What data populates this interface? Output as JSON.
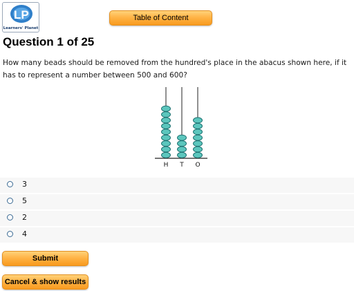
{
  "logo": {
    "brand_text": "Learners' Planet",
    "icon": "learners-planet-logo"
  },
  "header": {
    "toc_label": "Table of Content"
  },
  "question": {
    "title": "Question 1 of 25",
    "text": "How many beads should be removed from the hundred's place in the abacus shown here, if it has to represent a number between 500 and 600?"
  },
  "abacus": {
    "rods": [
      {
        "label": "H",
        "beads": 9
      },
      {
        "label": "T",
        "beads": 4
      },
      {
        "label": "O",
        "beads": 7
      }
    ],
    "bead_color": "#5cc6bd",
    "bead_outline": "#1c6f6f"
  },
  "options": [
    {
      "label": "3"
    },
    {
      "label": "5"
    },
    {
      "label": "2"
    },
    {
      "label": "4"
    }
  ],
  "actions": {
    "submit_label": "Submit",
    "cancel_label": "Cancel & show results"
  },
  "colors": {
    "button_orange": "#ffb447",
    "radio_border": "#3a6a93"
  }
}
